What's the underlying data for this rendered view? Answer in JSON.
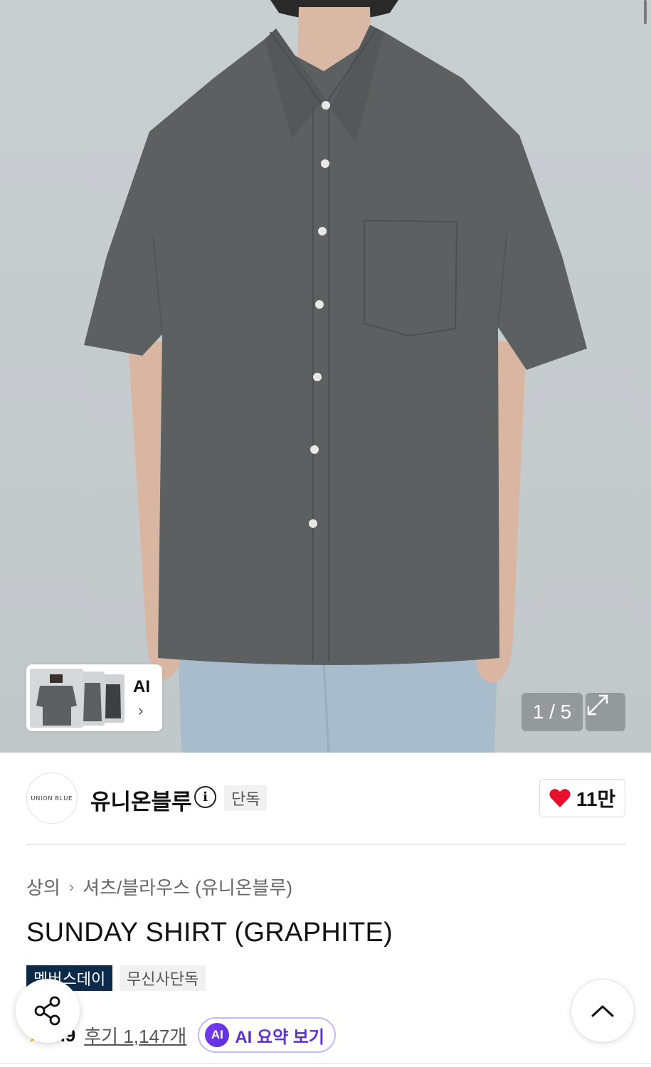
{
  "gallery": {
    "counter": "1 / 5",
    "ai_label": "AI",
    "ai_chevron": "›"
  },
  "brand": {
    "logo_text": "UNION BLUE",
    "name": "유니온블루",
    "info_glyph": "i",
    "exclusive_tag": "단독",
    "likes": "11만"
  },
  "product": {
    "breadcrumb": [
      "상의",
      "셔츠/블라우스 (유니온블루)"
    ],
    "breadcrumb_sep": "›",
    "title": "SUNDAY SHIRT (GRAPHITE)",
    "badges": {
      "member": "멤버스데이",
      "exclusive": "무신사단독"
    },
    "rating": "4.9",
    "reviews": "후기 1,147개",
    "ai_summary": {
      "icon": "AI",
      "label": "AI 요약 보기"
    }
  },
  "icons": {
    "expand": "expand-icon",
    "heart": "heart-icon",
    "share": "share-icon",
    "scroll_top": "chevron-up-icon",
    "star": "star-icon",
    "info": "info-icon"
  },
  "colors": {
    "heart": "#e8102a",
    "member_badge": "#0c2b4a",
    "ai_purple": "#5a2fd8",
    "shirt": "#5d6061"
  }
}
